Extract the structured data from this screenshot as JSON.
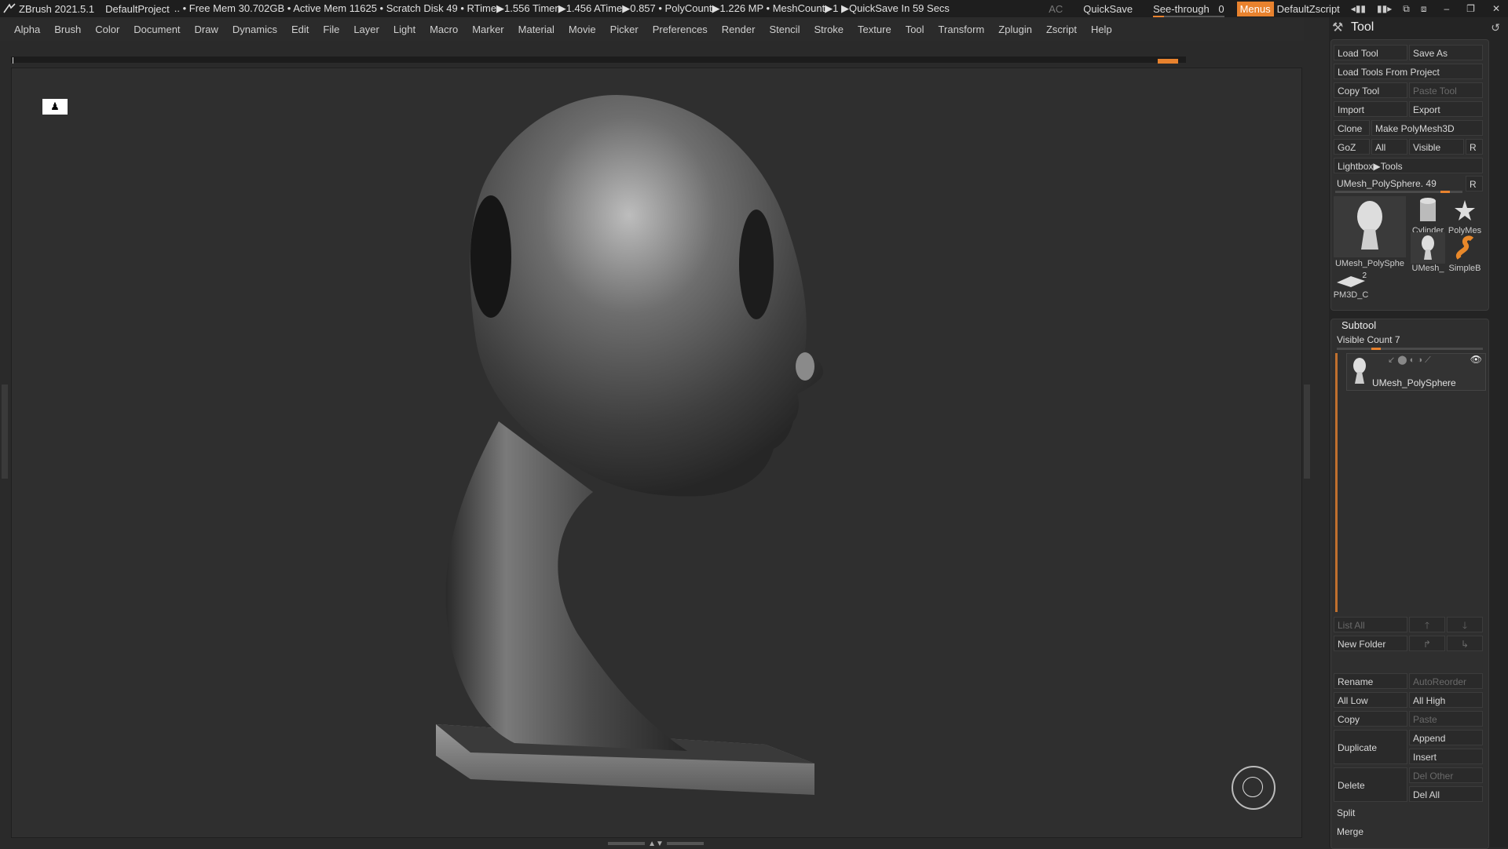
{
  "titlebar": {
    "app": "ZBrush 2021.5.1",
    "project": "DefaultProject",
    "stats": ".. • Free Mem 30.702GB • Active Mem 11625 • Scratch Disk 49 •  RTime▶1.556 Timer▶1.456 ATime▶0.857 • PolyCount▶1.226 MP  • MeshCount▶1  ▶QuickSave In 59 Secs",
    "ac": "AC",
    "quicksave": "QuickSave",
    "seethrough_label": "See-through",
    "seethrough_value": "0",
    "menus": "Menus",
    "script": "DefaultZscript"
  },
  "menubar": {
    "items": [
      "Alpha",
      "Brush",
      "Color",
      "Document",
      "Draw",
      "Dynamics",
      "Edit",
      "File",
      "Layer",
      "Light",
      "Macro",
      "Marker",
      "Material",
      "Movie",
      "Picker",
      "Preferences",
      "Render",
      "Stencil",
      "Stroke",
      "Texture",
      "Tool",
      "Transform",
      "Zplugin",
      "Zscript",
      "Help"
    ]
  },
  "tool_panel": {
    "title": "Tool",
    "load_tool": "Load Tool",
    "save_as": "Save As",
    "load_from_project": "Load Tools From Project",
    "copy_tool": "Copy Tool",
    "paste_tool": "Paste Tool",
    "import": "Import",
    "export": "Export",
    "clone": "Clone",
    "make_polymesh": "Make PolyMesh3D",
    "goz": "GoZ",
    "all": "All",
    "visible": "Visible",
    "r": "R",
    "lightbox_tools": "Lightbox▶Tools",
    "current_tool": "UMesh_PolySphere. 49",
    "current_tool_slider": 0.9,
    "thumbs": {
      "main": "UMesh_PolySphe",
      "cylinder": "Cylinder",
      "polymesh": "PolyMes",
      "umesh_small": "UMesh_",
      "simpleb": "SimpleB",
      "pm3d": "PM3D_C",
      "pm3d_count": "2"
    }
  },
  "subtool": {
    "title": "Subtool",
    "visible_count": "Visible Count 7",
    "visible_count_slider": 0.3,
    "item_name": "UMesh_PolySphere",
    "list_all": "List All",
    "new_folder": "New Folder",
    "rename": "Rename",
    "autoreorder": "AutoReorder",
    "all_low": "All Low",
    "all_high": "All High",
    "copy": "Copy",
    "paste": "Paste",
    "duplicate": "Duplicate",
    "append": "Append",
    "insert": "Insert",
    "delete": "Delete",
    "del_other": "Del Other",
    "del_all": "Del All",
    "split": "Split",
    "merge": "Merge"
  },
  "colors": {
    "accent": "#e8822e",
    "background": "#2a2a2a",
    "viewport": "#2f2f2f"
  }
}
